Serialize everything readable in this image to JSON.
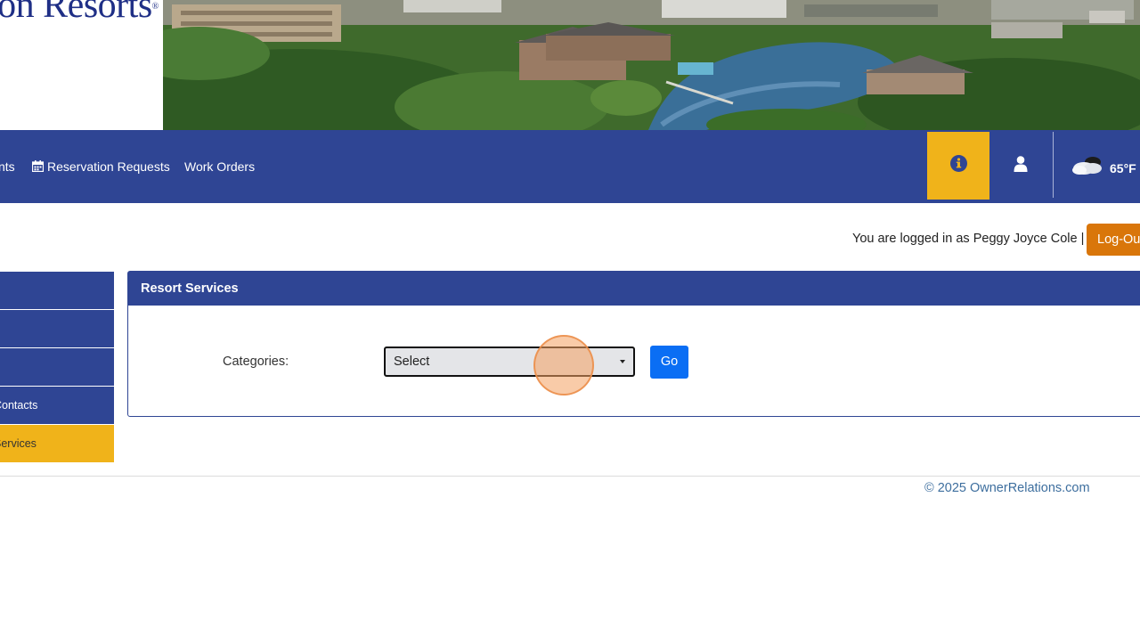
{
  "header": {
    "logo_text": "ton Resorts",
    "logo_mark": "®"
  },
  "nav": {
    "items": [
      {
        "label": "nts"
      },
      {
        "label": "Reservation Requests"
      },
      {
        "label": "Work Orders"
      }
    ],
    "weather": {
      "temp": "65°F"
    }
  },
  "session": {
    "logged_in_text": "You are logged in as Peggy Joyce Cole |",
    "logout_label": "Log-Out"
  },
  "sidebar": {
    "items": [
      {
        "label": ""
      },
      {
        "label": ""
      },
      {
        "label": ""
      },
      {
        "label": "Contacts"
      },
      {
        "label": "Services"
      }
    ]
  },
  "panel": {
    "title": "Resort Services",
    "categories_label": "Categories:",
    "select_value": "Select",
    "go_label": "Go"
  },
  "footer": {
    "copyright": "© 2025 OwnerRelations.com"
  },
  "colors": {
    "brand_blue": "#2f4594",
    "accent_gold": "#f0b31a",
    "logout_orange": "#d9760a",
    "go_blue": "#0a6ef4"
  }
}
